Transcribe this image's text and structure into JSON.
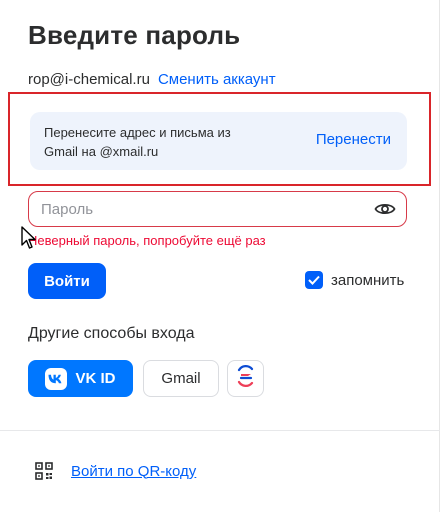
{
  "page": {
    "title": "Введите пароль"
  },
  "account": {
    "email": "rop@i-chemical.ru",
    "switch_label": "Сменить аккаунт"
  },
  "transfer": {
    "text": "Перенесите адрес и письма из Gmail на @xmail.ru",
    "button_label": "Перенести"
  },
  "password": {
    "placeholder": "Пароль",
    "value": ""
  },
  "error": {
    "message": "Неверный пароль, попробуйте ещё раз"
  },
  "login": {
    "button_label": "Войти",
    "remember_label": "запомнить",
    "remember_checked": true
  },
  "other_methods": {
    "title": "Другие способы входа",
    "vk_label": "VK ID",
    "gmail_label": "Gmail"
  },
  "qr": {
    "label": "Войти по QR-коду"
  },
  "colors": {
    "accent": "#005ff9",
    "vk": "#0077ff",
    "error": "#ed0a34",
    "highlight": "#d9252a",
    "banner_bg": "#eef3fc"
  }
}
